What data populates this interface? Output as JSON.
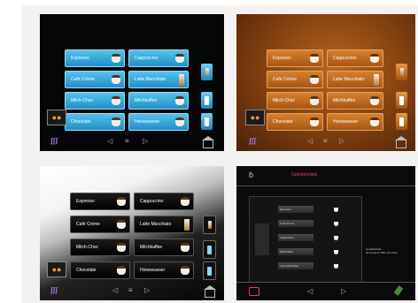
{
  "drinks": [
    {
      "label": "Espresso",
      "visual": "cup"
    },
    {
      "label": "Cappuccino",
      "visual": "cup"
    },
    {
      "label": "Café Crème",
      "visual": "cup"
    },
    {
      "label": "Latte Macchiato",
      "visual": "glass"
    },
    {
      "label": "Milch-Choc",
      "visual": "cup"
    },
    {
      "label": "Milchkaffee",
      "visual": "cup"
    },
    {
      "label": "Chocolate",
      "visual": "cup"
    },
    {
      "label": "Heisswasser",
      "visual": "cup"
    }
  ],
  "nav": {
    "back": "◁",
    "menu": "≡",
    "forward": "▷"
  },
  "beans_glyph": "●●",
  "hz_glyph": "ʃʃʃ",
  "panel4": {
    "title": "Getränkeliste",
    "rows": [
      "Espresso",
      "Café Crème",
      "Cappuccino",
      "Milchkaffee",
      "Latte Macchiato"
    ],
    "description_line1": "Getränkeliste",
    "description_line2": "für Dynamic Milk und Choc"
  },
  "colors": {
    "blue": "#1f8fc7",
    "amber": "#a95514",
    "accent_red": "#e0405a",
    "purple": "#b07ae0"
  }
}
